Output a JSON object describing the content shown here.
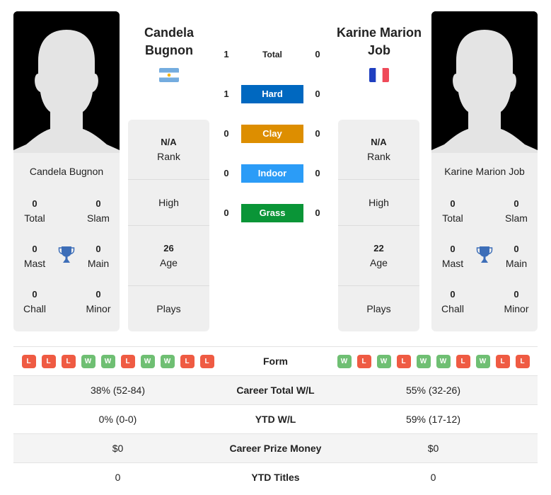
{
  "player1": {
    "name": "Candela Bugnon",
    "name_line1": "Candela",
    "name_line2": "Bugnon",
    "country_flag": "argentina-flag",
    "titles": {
      "total": {
        "value": "0",
        "label": "Total"
      },
      "slam": {
        "value": "0",
        "label": "Slam"
      },
      "mast": {
        "value": "0",
        "label": "Mast"
      },
      "main": {
        "value": "0",
        "label": "Main"
      },
      "chall": {
        "value": "0",
        "label": "Chall"
      },
      "minor": {
        "value": "0",
        "label": "Minor"
      }
    },
    "rank": {
      "value": "N/A",
      "label": "Rank"
    },
    "high": {
      "value": "",
      "label": "High"
    },
    "age": {
      "value": "26",
      "label": "Age"
    },
    "plays": {
      "value": "",
      "label": "Plays"
    }
  },
  "player2": {
    "name": "Karine Marion Job",
    "name_line1": "Karine Marion",
    "name_line2": "Job",
    "country_flag": "france-flag",
    "titles": {
      "total": {
        "value": "0",
        "label": "Total"
      },
      "slam": {
        "value": "0",
        "label": "Slam"
      },
      "mast": {
        "value": "0",
        "label": "Mast"
      },
      "main": {
        "value": "0",
        "label": "Main"
      },
      "chall": {
        "value": "0",
        "label": "Chall"
      },
      "minor": {
        "value": "0",
        "label": "Minor"
      }
    },
    "rank": {
      "value": "N/A",
      "label": "Rank"
    },
    "high": {
      "value": "",
      "label": "High"
    },
    "age": {
      "value": "22",
      "label": "Age"
    },
    "plays": {
      "value": "",
      "label": "Plays"
    }
  },
  "head_to_head": [
    {
      "label": "Total",
      "p1": "1",
      "p2": "0",
      "color": ""
    },
    {
      "label": "Hard",
      "p1": "1",
      "p2": "0",
      "color": "#0068c0"
    },
    {
      "label": "Clay",
      "p1": "0",
      "p2": "0",
      "color": "#dd8e00"
    },
    {
      "label": "Indoor",
      "p1": "0",
      "p2": "0",
      "color": "#2b9cf7"
    },
    {
      "label": "Grass",
      "p1": "0",
      "p2": "0",
      "color": "#0a9537"
    }
  ],
  "comparison": {
    "form": {
      "label": "Form",
      "p1": [
        "L",
        "L",
        "L",
        "W",
        "W",
        "L",
        "W",
        "W",
        "L",
        "L"
      ],
      "p2": [
        "W",
        "L",
        "W",
        "L",
        "W",
        "W",
        "L",
        "W",
        "L",
        "L"
      ]
    },
    "rows": [
      {
        "label": "Career Total W/L",
        "p1": "38% (52-84)",
        "p2": "55% (32-26)"
      },
      {
        "label": "YTD W/L",
        "p1": "0% (0-0)",
        "p2": "59% (17-12)"
      },
      {
        "label": "Career Prize Money",
        "p1": "$0",
        "p2": "$0"
      },
      {
        "label": "YTD Titles",
        "p1": "0",
        "p2": "0"
      }
    ]
  },
  "colors": {
    "win": "#6fbf73",
    "loss": "#ef5b43",
    "trophy": "#3d6eb8",
    "panel": "#efefef"
  }
}
